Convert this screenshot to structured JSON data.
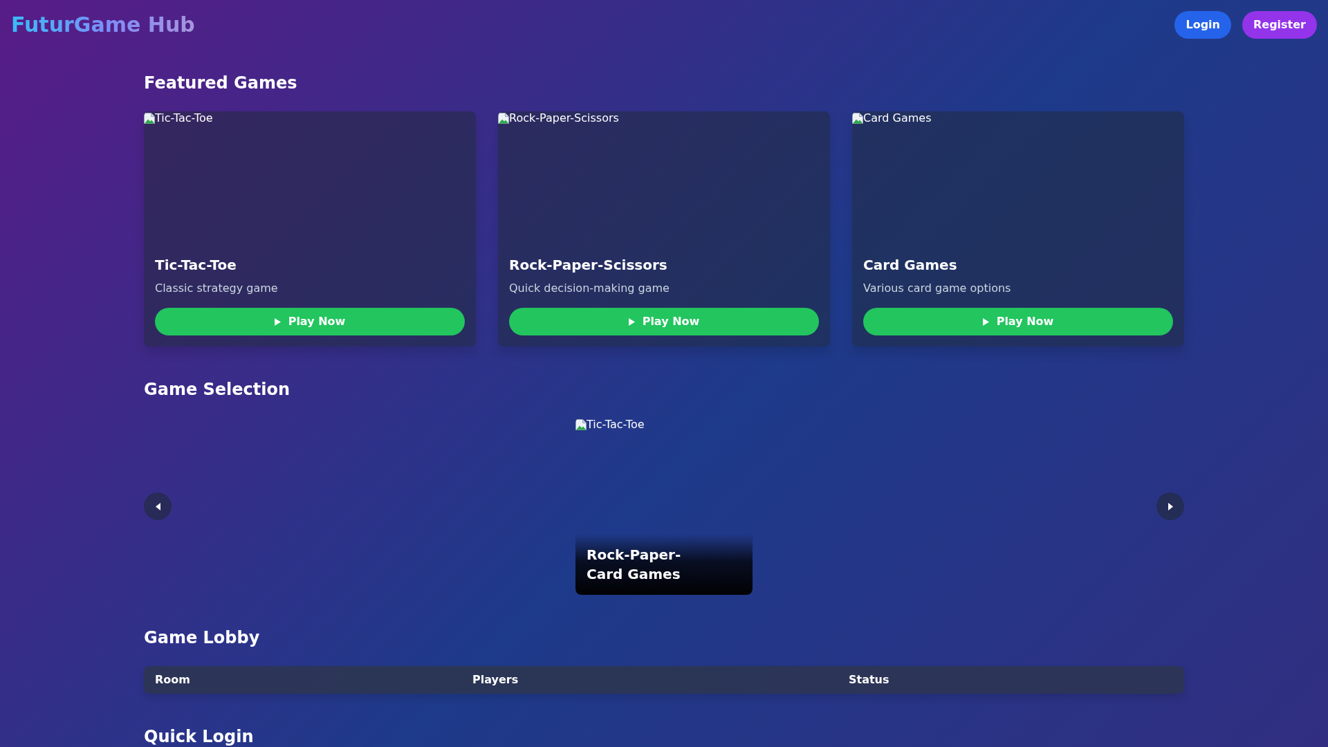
{
  "header": {
    "logo": "FuturGame Hub",
    "buttons": [
      {
        "label": "Login",
        "kind": "primary"
      },
      {
        "label": "Register",
        "kind": "secondary"
      }
    ]
  },
  "featured_games": {
    "title": "Featured Games",
    "games": [
      {
        "image_alt": "Tic-Tac-Toe",
        "title": "Tic-Tac-Toe",
        "description": "Classic strategy game",
        "button": "Play Now"
      },
      {
        "image_alt": "Rock-Paper-Scissors",
        "title": "Rock-Paper-Scissors",
        "description": "Quick decision-making game",
        "button": "Play Now"
      },
      {
        "image_alt": "Card Games",
        "title": "Card Games",
        "description": "Various card game options",
        "button": "Play Now"
      }
    ]
  },
  "game_selection": {
    "title": "Game Selection",
    "slide": {
      "image_alt": "Tic-Tac-Toe",
      "captions": [
        "Rock-Paper-",
        "Card Games"
      ]
    }
  },
  "game_lobby": {
    "title": "Game Lobby",
    "columns": [
      "Room",
      "Players",
      "Status"
    ]
  },
  "quick_login": {
    "title": "Quick Login"
  }
}
